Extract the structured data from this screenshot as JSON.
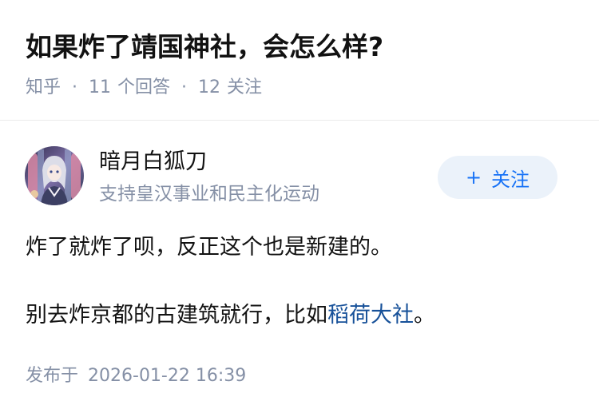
{
  "question": {
    "title": "如果炸了靖国神社，会怎么样?",
    "source": "知乎",
    "answers_count": "11",
    "answers_label": "个回答",
    "followers_count": "12",
    "followers_label": "关注"
  },
  "author": {
    "name": "暗月白狐刀",
    "bio": "支持皇汉事业和民主化运动",
    "follow_label": "关注"
  },
  "answer": {
    "paragraph1": "炸了就炸了呗，反正这个也是新建的。",
    "paragraph2_prefix": "别去炸京都的古建筑就行，比如",
    "paragraph2_link": "稻荷大社",
    "paragraph2_suffix": "。"
  },
  "footer": {
    "published_label": "发布于",
    "published_date": "2026-01-22 16:39"
  },
  "colors": {
    "meta_gray": "#8590a6",
    "link_blue": "#175199",
    "button_blue": "#1772f6",
    "button_bg": "#ebf2fa"
  },
  "icons": {
    "follow_icon": "plus-icon"
  }
}
